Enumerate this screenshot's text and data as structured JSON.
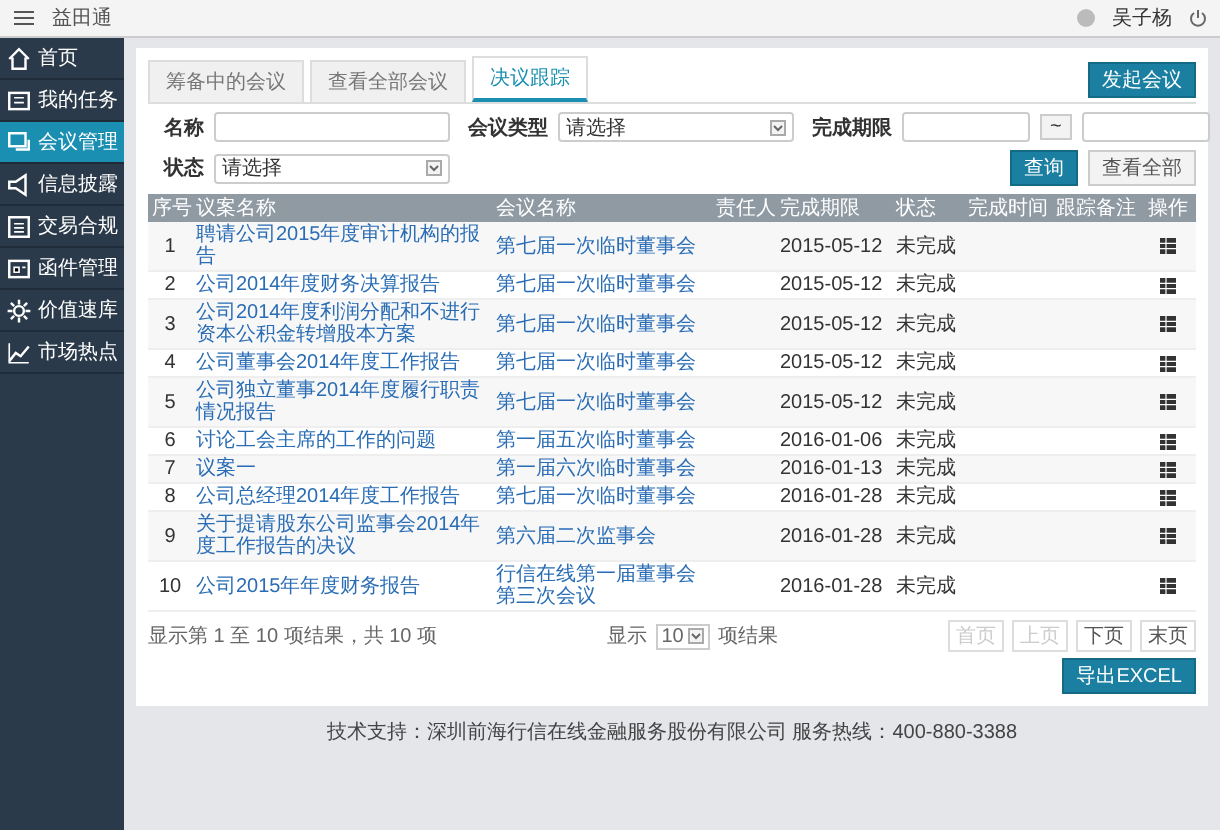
{
  "topbar": {
    "app_title": "益田通",
    "user": "吴子杨"
  },
  "sidebar": {
    "items": [
      {
        "label": "首页",
        "selected": false
      },
      {
        "label": "我的任务",
        "selected": false
      },
      {
        "label": "会议管理",
        "selected": true
      },
      {
        "label": "信息披露",
        "selected": false
      },
      {
        "label": "交易合规",
        "selected": false
      },
      {
        "label": "函件管理",
        "selected": false
      },
      {
        "label": "价值速库",
        "selected": false
      },
      {
        "label": "市场热点",
        "selected": false
      }
    ]
  },
  "tabs": [
    {
      "label": "筹备中的会议",
      "selected": false
    },
    {
      "label": "查看全部会议",
      "selected": false
    },
    {
      "label": "决议跟踪",
      "selected": true
    }
  ],
  "new_meeting_button": "发起会议",
  "filters": {
    "name_label": "名称",
    "type_label": "会议类型",
    "type_value": "请选择",
    "deadline_label": "完成期限",
    "range_sep": "~",
    "status_label": "状态",
    "status_value": "请选择",
    "query_button": "查询",
    "show_all_button": "查看全部"
  },
  "table": {
    "columns": [
      "序号",
      "议案名称",
      "会议名称",
      "责任人",
      "完成期限",
      "状态",
      "完成时间",
      "跟踪备注",
      "操作"
    ],
    "rows": [
      {
        "no": "1",
        "proposal": "聘请公司2015年度审计机构的报告",
        "meeting": "第七届一次临时董事会",
        "deadline": "2015-05-12",
        "status": "未完成"
      },
      {
        "no": "2",
        "proposal": "公司2014年度财务决算报告",
        "meeting": "第七届一次临时董事会",
        "deadline": "2015-05-12",
        "status": "未完成"
      },
      {
        "no": "3",
        "proposal": "公司2014年度利润分配和不进行资本公积金转增股本方案",
        "meeting": "第七届一次临时董事会",
        "deadline": "2015-05-12",
        "status": "未完成"
      },
      {
        "no": "4",
        "proposal": "公司董事会2014年度工作报告",
        "meeting": "第七届一次临时董事会",
        "deadline": "2015-05-12",
        "status": "未完成"
      },
      {
        "no": "5",
        "proposal": "公司独立董事2014年度履行职责情况报告",
        "meeting": "第七届一次临时董事会",
        "deadline": "2015-05-12",
        "status": "未完成"
      },
      {
        "no": "6",
        "proposal": "讨论工会主席的工作的问题",
        "meeting": "第一届五次临时董事会",
        "deadline": "2016-01-06",
        "status": "未完成"
      },
      {
        "no": "7",
        "proposal": "议案一",
        "meeting": "第一届六次临时董事会",
        "deadline": "2016-01-13",
        "status": "未完成"
      },
      {
        "no": "8",
        "proposal": "公司总经理2014年度工作报告",
        "meeting": "第七届一次临时董事会",
        "deadline": "2016-01-28",
        "status": "未完成"
      },
      {
        "no": "9",
        "proposal": "关于提请股东公司监事会2014年度工作报告的决议",
        "meeting": "第六届二次监事会",
        "deadline": "2016-01-28",
        "status": "未完成"
      },
      {
        "no": "10",
        "proposal": "公司2015年年度财务报告",
        "meeting": "行信在线第一届董事会第三次会议",
        "deadline": "2016-01-28",
        "status": "未完成"
      }
    ]
  },
  "pager": {
    "summary": "显示第 1 至 10 项结果，共 10 项",
    "show_label": "显示",
    "page_size": "10",
    "per_page_label": "项结果",
    "buttons": [
      {
        "label": "首页",
        "disabled": true
      },
      {
        "label": "上页",
        "disabled": true
      },
      {
        "label": "下页",
        "disabled": false
      },
      {
        "label": "末页",
        "disabled": false
      }
    ]
  },
  "export_button": "导出EXCEL",
  "footer": "技术支持：深圳前海行信在线金融服务股份有限公司 服务热线：400-880-3388"
}
